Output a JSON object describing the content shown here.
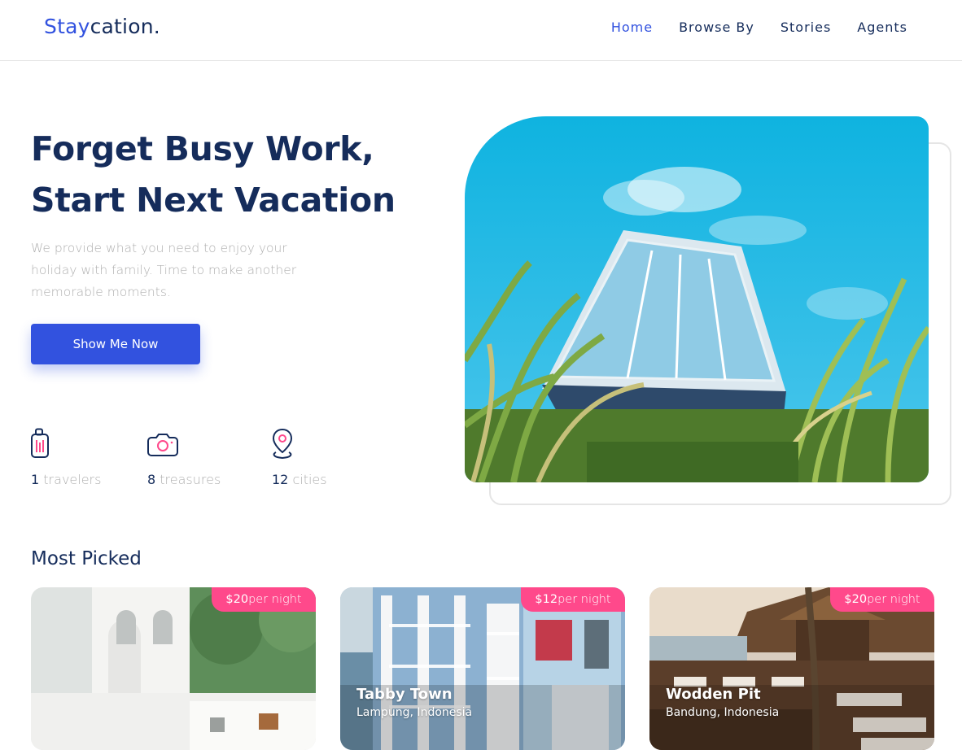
{
  "brand": {
    "part1": "Stay",
    "part2": "cation."
  },
  "nav": [
    {
      "label": "Home",
      "active": true
    },
    {
      "label": "Browse By",
      "active": false
    },
    {
      "label": "Stories",
      "active": false
    },
    {
      "label": "Agents",
      "active": false
    }
  ],
  "hero": {
    "title_line1": "Forget Busy Work,",
    "title_line2": "Start Next Vacation",
    "description": "We provide what you need to enjoy your holiday with family. Time to make another memorable moments.",
    "button_label": "Show Me Now",
    "image_alt": "Glass house on a hillside",
    "stats": [
      {
        "icon": "luggage-icon",
        "value": "1",
        "label": "travelers"
      },
      {
        "icon": "camera-icon",
        "value": "8",
        "label": "treasures"
      },
      {
        "icon": "map-pin-icon",
        "value": "12",
        "label": "cities"
      }
    ]
  },
  "most_picked": {
    "title": "Most Picked",
    "cards": [
      {
        "price": "$20",
        "unit": "per night",
        "name": "",
        "location": ""
      },
      {
        "price": "$12",
        "unit": "per night",
        "name": "Tabby Town",
        "location": "Lampung, Indonesia"
      },
      {
        "price": "$20",
        "unit": "per night",
        "name": "Wodden Pit",
        "location": "Bandung, Indonesia"
      }
    ]
  },
  "colors": {
    "primary": "#3252df",
    "navy": "#152c5b",
    "gray": "#b0b0b0",
    "pink": "#ff498b"
  }
}
